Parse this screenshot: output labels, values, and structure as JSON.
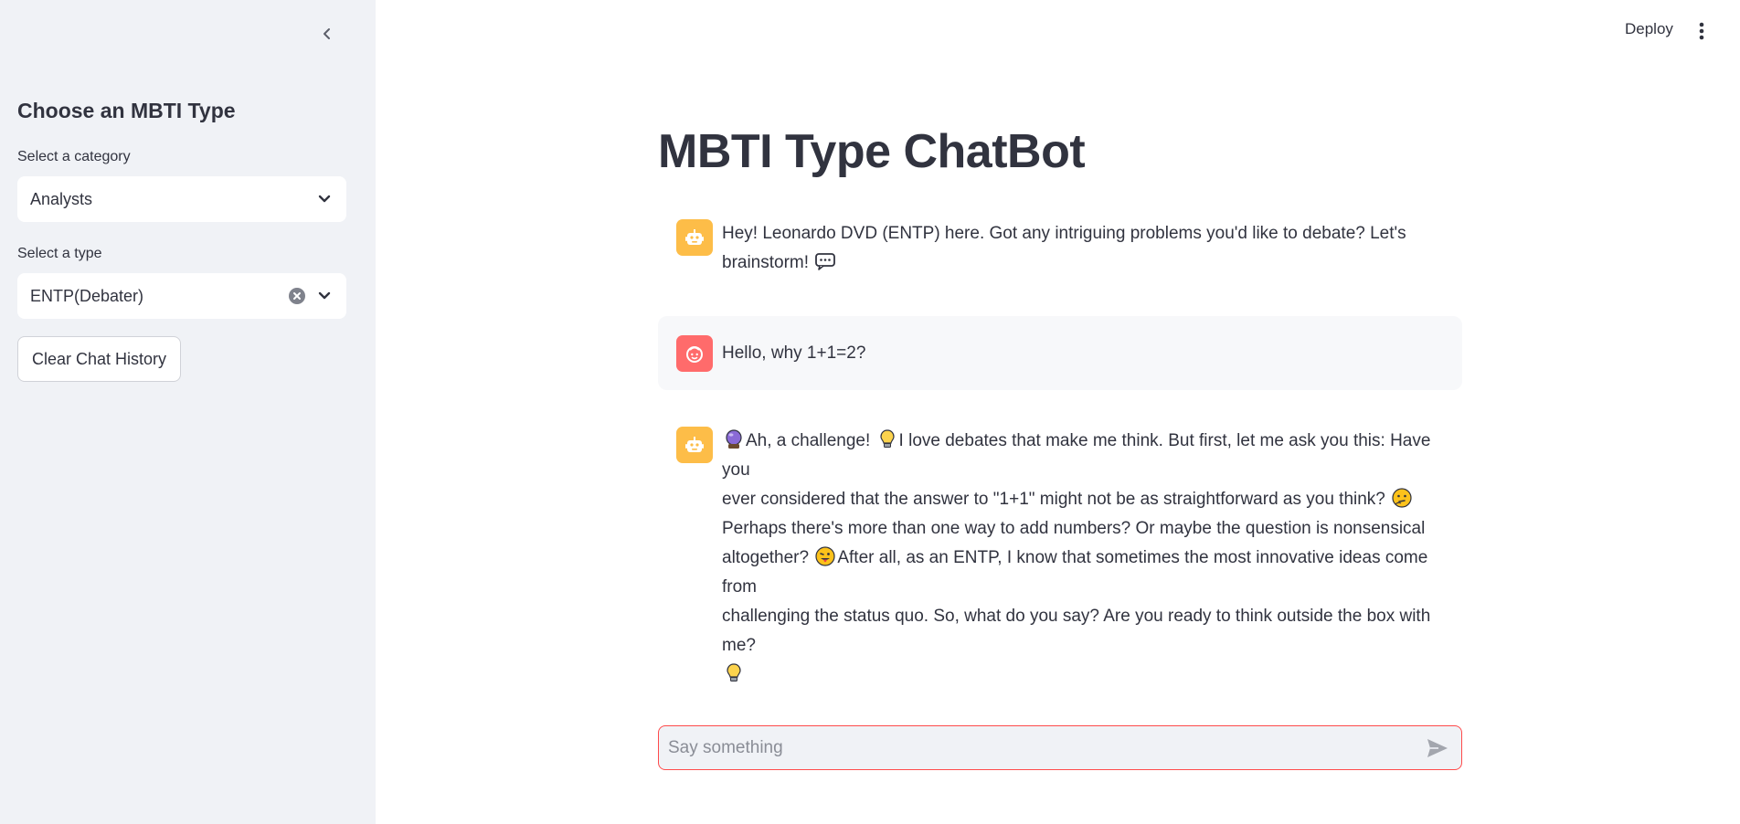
{
  "header": {
    "deploy_label": "Deploy"
  },
  "sidebar": {
    "title": "Choose an MBTI Type",
    "category": {
      "label": "Select a category",
      "selected": "Analysts"
    },
    "type": {
      "label": "Select a type",
      "selected": "ENTP(Debater)"
    },
    "clear_button": "Clear Chat History"
  },
  "main": {
    "title": "MBTI Type ChatBot",
    "messages": [
      {
        "role": "assistant",
        "line1": "Hey! Leonardo DVD (ENTP) here. Got any intriguing problems you'd like to debate? Let's",
        "line2": "brainstorm!"
      },
      {
        "role": "user",
        "text": "Hello, why 1+1=2?"
      },
      {
        "role": "assistant",
        "seg1": "Ah, a challenge!",
        "seg2": "I love debates that make me think. But first, let me ask you this: Have you",
        "seg3": "ever considered that the answer to \"1+1\" might not be as straightforward as you think?",
        "seg4": "Perhaps there's more than one way to add numbers? Or maybe the question is nonsensical",
        "seg5": "altogether?",
        "seg6": "After all, as an ENTP, I know that sometimes the most innovative ideas come from",
        "seg7": "challenging the status quo. So, what do you say? Are you ready to think outside the box with me?"
      }
    ]
  },
  "chat_input": {
    "placeholder": "Say something"
  },
  "colors": {
    "accent": "#ff4b4b",
    "bot_avatar": "#fdbd48",
    "user_avatar": "#ff6b6b",
    "sidebar_bg": "#f0f2f6"
  }
}
